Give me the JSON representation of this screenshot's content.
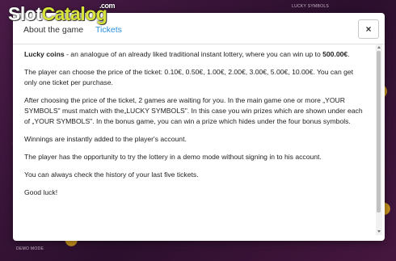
{
  "logo": {
    "part1": "Slot",
    "part2": "Catalog",
    "suffix": ".com"
  },
  "background": {
    "lucky_symbols": "LUCKY SYMBOLS",
    "demo_mode": "DEMO MODE"
  },
  "modal": {
    "tabs": [
      {
        "label": "About the game"
      },
      {
        "label": "Tickets"
      }
    ],
    "close_label": "×",
    "content": {
      "p1_bold": "Lucky coins",
      "p1_text": " - an analogue of an already liked traditional instant lottery, where you can win up to ",
      "p1_amount": "500.00€",
      "p1_end": ".",
      "p2": "The player can choose the price of the ticket: 0.10€, 0.50€, 1.00€, 2.00€, 3.00€, 5.00€, 10.00€. You can get only one ticket per purchase.",
      "p3": "After choosing the price of the ticket, 2 games are waiting for you. In the main game one or more „YOUR SYMBOLS\" must match with the„LUCKY SYMBOLS\". In this case you win prizes which are shown under each of „YOUR SYMBOLS\". In the bonus game, you can win a prize which hides under the four bonus symbols.",
      "p4": "Winnings are instantly added to the player's account.",
      "p5": "The player has the opportunity to try the lottery in a demo mode without signing in to his account.",
      "p6": "You can always check the history of your last five tickets.",
      "p7": "Good luck!"
    }
  },
  "colors": {
    "tab_active": "#2b8fdc",
    "logo_accent": "#d9e43a",
    "backdrop": "#3a1638"
  }
}
